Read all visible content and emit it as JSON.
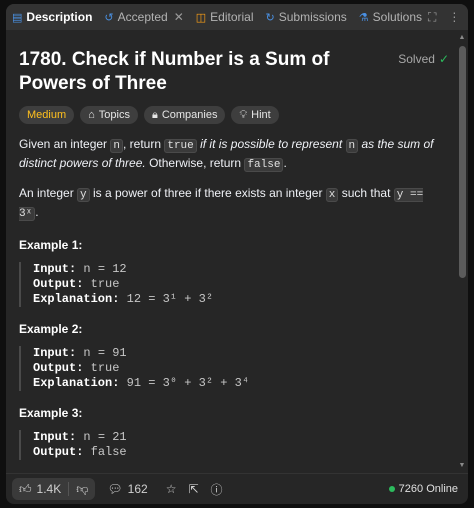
{
  "tabs": [
    {
      "label": "Description",
      "icon": "document-icon",
      "active": true
    },
    {
      "label": "Accepted",
      "icon": "history-icon",
      "closable": true
    },
    {
      "label": "Editorial",
      "icon": "book-icon"
    },
    {
      "label": "Submissions",
      "icon": "refresh-icon"
    },
    {
      "label": "Solutions",
      "icon": "flask-icon"
    }
  ],
  "problem": {
    "title": "1780. Check if Number is a Sum of Powers of Three",
    "status": "Solved",
    "difficulty": "Medium",
    "tags": [
      "Topics",
      "Companies",
      "Hint"
    ]
  },
  "description": {
    "p1_a": "Given an integer ",
    "p1_code1": "n",
    "p1_b": ", return ",
    "p1_code2": "true",
    "p1_c": " if it is possible to represent ",
    "p1_code3": "n",
    "p1_d": " as the sum of distinct powers of three.",
    "p1_e": " Otherwise, return ",
    "p1_code4": "false",
    "p1_f": ".",
    "p2_a": "An integer ",
    "p2_code1": "y",
    "p2_b": " is a power of three if there exists an integer ",
    "p2_code2": "x",
    "p2_c": " such that ",
    "p2_code3": "y == 3ˣ",
    "p2_d": "."
  },
  "examples": [
    {
      "title": "Example 1:",
      "input": "n = 12",
      "output": "true",
      "explanation": "12 = 3¹ + 3²"
    },
    {
      "title": "Example 2:",
      "input": "n = 91",
      "output": "true",
      "explanation": "91 = 3⁰ + 3² + 3⁴"
    },
    {
      "title": "Example 3:",
      "input": "n = 21",
      "output": "false"
    }
  ],
  "labels": {
    "input": "Input:",
    "output": "Output:",
    "explanation": "Explanation:"
  },
  "footer": {
    "likes": "1.4K",
    "comments": "162",
    "online": "7260 Online"
  },
  "colors": {
    "accent_medium": "#ffc01e",
    "solved_green": "#2cbb5d"
  }
}
